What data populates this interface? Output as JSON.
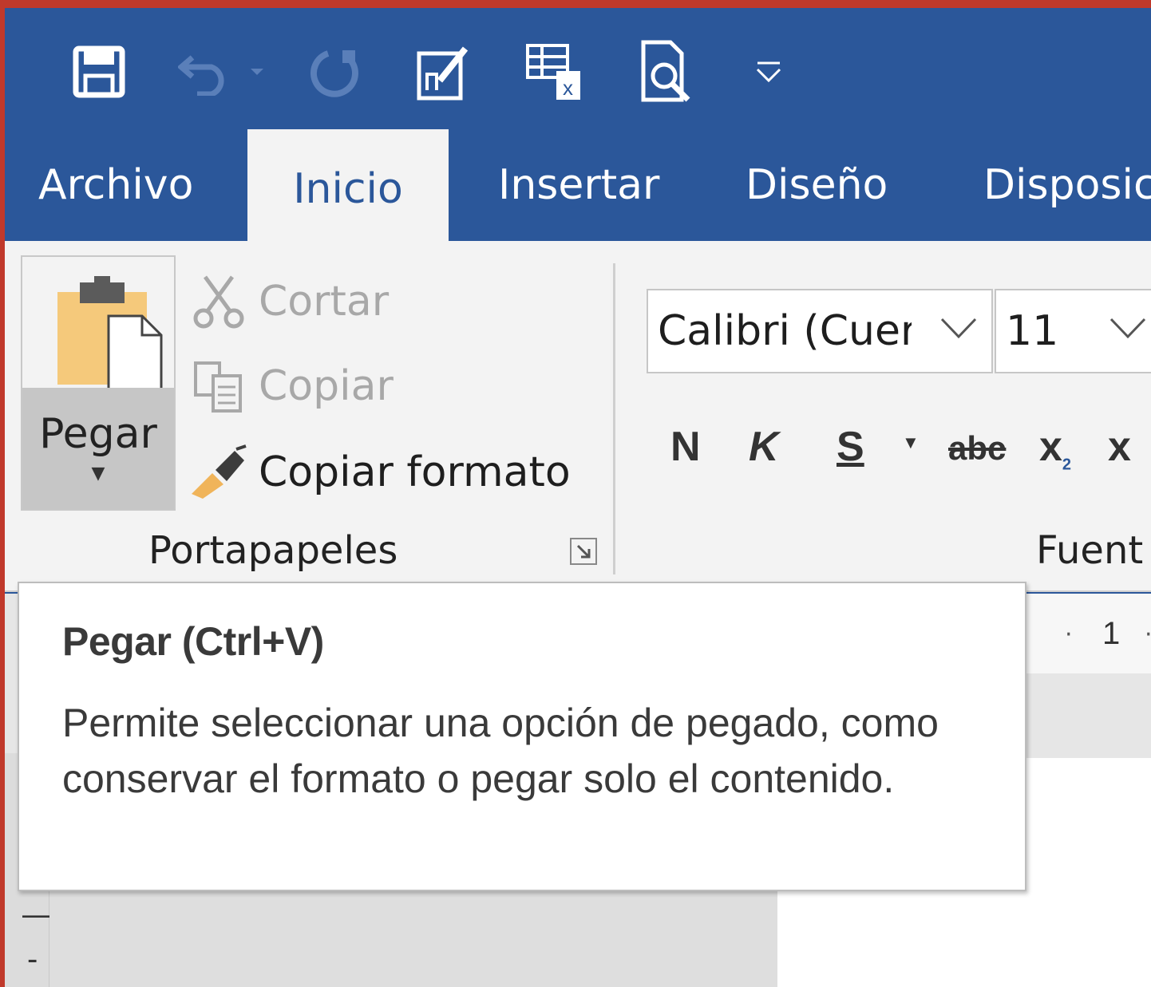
{
  "qat": {
    "icons": [
      "save-icon",
      "undo-icon",
      "undo-dropdown-icon",
      "redo-icon",
      "edit-document-icon",
      "table-icon",
      "print-preview-icon",
      "customize-qat-icon"
    ]
  },
  "tabs": [
    {
      "label": "Archivo"
    },
    {
      "label": "Inicio"
    },
    {
      "label": "Insertar"
    },
    {
      "label": "Diseño"
    },
    {
      "label": "Disposici"
    }
  ],
  "clipboard": {
    "paste_label": "Pegar",
    "cut_label": "Cortar",
    "copy_label": "Copiar",
    "format_painter_label": "Copiar formato",
    "group_label": "Portapapeles"
  },
  "font": {
    "font_name": "Calibri (Cuer",
    "font_size": "11",
    "bold": "N",
    "italic": "K",
    "underline": "S",
    "strikethrough": "abc",
    "subscript": "x",
    "group_label": "Fuent"
  },
  "ruler": {
    "number": "1"
  },
  "tooltip": {
    "title": "Pegar (Ctrl+V)",
    "description": "Permite seleccionar una opción de pegado, como conservar el formato o pegar solo el contenido."
  },
  "colors": {
    "title_bar": "#2b579a",
    "ribbon": "#f3f3f3",
    "window_border": "#c0392b"
  }
}
